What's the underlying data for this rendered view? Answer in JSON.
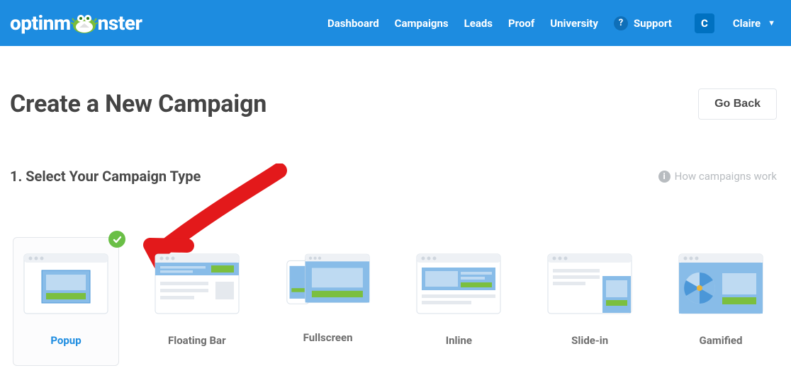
{
  "brand": "optinm  nster",
  "nav": {
    "dashboard": "Dashboard",
    "campaigns": "Campaigns",
    "leads": "Leads",
    "proof": "Proof",
    "university": "University",
    "support": "Support",
    "user_initial": "C",
    "username": "Claire"
  },
  "page": {
    "title": "Create a New Campaign",
    "go_back": "Go Back",
    "step_label": "1. Select Your Campaign Type",
    "hint": "How campaigns work"
  },
  "types": {
    "0": "Popup",
    "1": "Floating Bar",
    "2": "Fullscreen",
    "3": "Inline",
    "4": "Slide-in",
    "5": "Gamified"
  }
}
